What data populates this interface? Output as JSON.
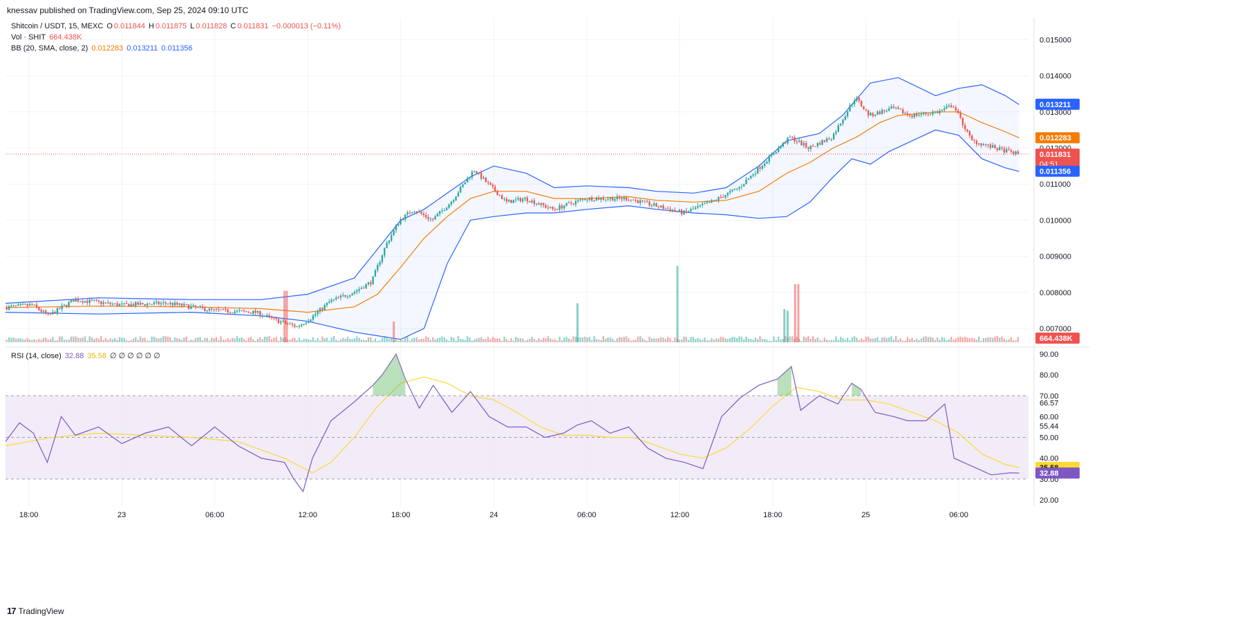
{
  "header": {
    "published": "knessav published on TradingView.com, Sep 25, 2024 09:10 UTC"
  },
  "legend": {
    "symbol": "Shitcoin / USDT, 15, MEXC",
    "o_label": "O",
    "o": "0.011844",
    "h_label": "H",
    "h": "0.011875",
    "l_label": "L",
    "l": "0.011828",
    "c_label": "C",
    "c": "0.011831",
    "change": "−0.000013 (−0.11%)",
    "vol_label": "Vol · SHIT",
    "vol_value": "664.438K",
    "bb_label": "BB (20, SMA, close, 2)",
    "bb_basis": "0.012283",
    "bb_upper": "0.013211",
    "bb_lower": "0.011356",
    "rsi_label": "RSI (14, close)",
    "rsi_value": "32.88",
    "rsi_ma": "35.58",
    "rsi_extra": "∅ ∅ ∅ ∅ ∅ ∅"
  },
  "badges": {
    "upper": "0.013211",
    "basis": "0.012283",
    "price": "0.011831",
    "countdown": "04:51",
    "lower": "0.011356",
    "volume": "664.438K",
    "rsi_ma": "35.58",
    "rsi": "32.88"
  },
  "footer": {
    "brand": "TradingView"
  },
  "colors": {
    "up": "#26a69a",
    "down": "#ef5350",
    "bb_band": "#2962ff",
    "bb_basis": "#f57c00",
    "rsi_line": "#7e57c2",
    "rsi_ma": "#fdd835",
    "rsi_bg": "#ede7f6",
    "price_line": "#ef5350"
  },
  "chart_data": [
    {
      "type": "candlestick",
      "title": "Shitcoin / USDT, 15, MEXC",
      "y_tick_labels": [
        "0.015000",
        "0.014000",
        "0.013000",
        "0.012000",
        "0.011000",
        "0.010000",
        "0.009000",
        "0.008000",
        "0.007000"
      ],
      "y_ticks": [
        0.015,
        0.014,
        0.013,
        0.012,
        0.011,
        0.01,
        0.009,
        0.008,
        0.007
      ],
      "ylim": [
        0.0066,
        0.0156
      ],
      "x_labels": [
        "18:00",
        "23",
        "06:00",
        "12:00",
        "18:00",
        "24",
        "06:00",
        "12:00",
        "18:00",
        "25",
        "06:00"
      ],
      "x_label_pos": [
        0.5,
        2.5,
        4.5,
        6.5,
        8.5,
        10.5,
        12.5,
        14.5,
        16.5,
        18.5,
        20.5
      ],
      "x_start": 0,
      "x_end": 22.0,
      "current_price": 0.011831,
      "close_path": [
        [
          0.0,
          0.00758
        ],
        [
          0.6,
          0.00765
        ],
        [
          0.95,
          0.00735
        ],
        [
          1.5,
          0.0078
        ],
        [
          2.5,
          0.00765
        ],
        [
          3.5,
          0.0077
        ],
        [
          4.5,
          0.0075
        ],
        [
          5.4,
          0.00745
        ],
        [
          5.9,
          0.0072
        ],
        [
          6.3,
          0.00705
        ],
        [
          6.6,
          0.0073
        ],
        [
          7.0,
          0.00775
        ],
        [
          7.5,
          0.008
        ],
        [
          7.9,
          0.0083
        ],
        [
          8.2,
          0.0093
        ],
        [
          8.5,
          0.01
        ],
        [
          8.8,
          0.0103
        ],
        [
          9.2,
          0.01
        ],
        [
          9.6,
          0.0105
        ],
        [
          10.1,
          0.0114
        ],
        [
          10.4,
          0.011
        ],
        [
          10.8,
          0.0105
        ],
        [
          11.2,
          0.0106
        ],
        [
          11.8,
          0.0103
        ],
        [
          12.5,
          0.0106
        ],
        [
          13.4,
          0.0106
        ],
        [
          14.0,
          0.0104
        ],
        [
          14.6,
          0.0102
        ],
        [
          15.2,
          0.0105
        ],
        [
          15.8,
          0.0109
        ],
        [
          16.5,
          0.0118
        ],
        [
          16.9,
          0.0123
        ],
        [
          17.3,
          0.012
        ],
        [
          17.8,
          0.0123
        ],
        [
          18.3,
          0.0134
        ],
        [
          18.6,
          0.0129
        ],
        [
          19.1,
          0.0131
        ],
        [
          19.5,
          0.0129
        ],
        [
          20.1,
          0.013
        ],
        [
          20.4,
          0.0132
        ],
        [
          20.8,
          0.0122
        ],
        [
          21.3,
          0.012
        ],
        [
          21.8,
          0.01183
        ],
        [
          22.0,
          0.01183
        ]
      ],
      "bb_upper_path": [
        [
          0.0,
          0.0077
        ],
        [
          2.0,
          0.00785
        ],
        [
          4.0,
          0.0078
        ],
        [
          5.5,
          0.0078
        ],
        [
          6.5,
          0.00795
        ],
        [
          7.5,
          0.0084
        ],
        [
          8.0,
          0.0092
        ],
        [
          8.5,
          0.01
        ],
        [
          9.0,
          0.0103
        ],
        [
          10.0,
          0.0112
        ],
        [
          10.5,
          0.0115
        ],
        [
          11.2,
          0.0113
        ],
        [
          11.8,
          0.0109
        ],
        [
          12.5,
          0.01095
        ],
        [
          13.4,
          0.0109
        ],
        [
          14.0,
          0.0108
        ],
        [
          14.8,
          0.01075
        ],
        [
          15.5,
          0.0109
        ],
        [
          16.2,
          0.0115
        ],
        [
          16.8,
          0.0122
        ],
        [
          17.5,
          0.0124
        ],
        [
          18.0,
          0.0129
        ],
        [
          18.6,
          0.0138
        ],
        [
          19.2,
          0.01395
        ],
        [
          20.0,
          0.01345
        ],
        [
          20.5,
          0.01365
        ],
        [
          21.0,
          0.01375
        ],
        [
          21.5,
          0.01345
        ],
        [
          21.8,
          0.0132
        ]
      ],
      "bb_lower_path": [
        [
          0.0,
          0.00745
        ],
        [
          2.0,
          0.0074
        ],
        [
          4.0,
          0.00745
        ],
        [
          5.5,
          0.00735
        ],
        [
          6.5,
          0.0072
        ],
        [
          7.5,
          0.0069
        ],
        [
          8.0,
          0.0068
        ],
        [
          8.5,
          0.0067
        ],
        [
          9.0,
          0.007
        ],
        [
          9.5,
          0.0088
        ],
        [
          10.0,
          0.01
        ],
        [
          10.5,
          0.0101
        ],
        [
          11.2,
          0.0102
        ],
        [
          11.8,
          0.0102
        ],
        [
          12.5,
          0.0103
        ],
        [
          13.4,
          0.0104
        ],
        [
          14.0,
          0.0103
        ],
        [
          14.8,
          0.0102
        ],
        [
          15.5,
          0.01015
        ],
        [
          16.2,
          0.01005
        ],
        [
          16.8,
          0.0101
        ],
        [
          17.3,
          0.0105
        ],
        [
          17.8,
          0.0112
        ],
        [
          18.2,
          0.0117
        ],
        [
          18.6,
          0.01155
        ],
        [
          19.0,
          0.0119
        ],
        [
          20.0,
          0.0125
        ],
        [
          20.5,
          0.01235
        ],
        [
          21.0,
          0.0117
        ],
        [
          21.5,
          0.01145
        ],
        [
          21.8,
          0.01135
        ]
      ],
      "bb_basis_path": [
        [
          0.0,
          0.00758
        ],
        [
          2.0,
          0.00762
        ],
        [
          4.0,
          0.0076
        ],
        [
          5.5,
          0.00755
        ],
        [
          6.5,
          0.00745
        ],
        [
          7.5,
          0.0076
        ],
        [
          8.0,
          0.00795
        ],
        [
          8.5,
          0.0087
        ],
        [
          9.0,
          0.0095
        ],
        [
          9.5,
          0.0101
        ],
        [
          10.0,
          0.0106
        ],
        [
          10.5,
          0.0108
        ],
        [
          11.2,
          0.0108
        ],
        [
          11.8,
          0.0106
        ],
        [
          12.5,
          0.0106
        ],
        [
          13.4,
          0.01065
        ],
        [
          14.0,
          0.01055
        ],
        [
          14.8,
          0.0105
        ],
        [
          15.5,
          0.01055
        ],
        [
          16.2,
          0.0108
        ],
        [
          16.8,
          0.0113
        ],
        [
          17.3,
          0.0116
        ],
        [
          17.8,
          0.012
        ],
        [
          18.3,
          0.0123
        ],
        [
          18.8,
          0.0127
        ],
        [
          19.2,
          0.0129
        ],
        [
          20.0,
          0.013
        ],
        [
          20.5,
          0.013
        ],
        [
          21.0,
          0.0127
        ],
        [
          21.5,
          0.01245
        ],
        [
          21.8,
          0.01228
        ]
      ],
      "volume_spikes": [
        {
          "x": 6.0,
          "v": 0.62,
          "dir": "down"
        },
        {
          "x": 6.05,
          "v": 0.62,
          "dir": "down"
        },
        {
          "x": 8.35,
          "v": 0.25,
          "dir": "down"
        },
        {
          "x": 12.3,
          "v": 0.47,
          "dir": "up"
        },
        {
          "x": 14.45,
          "v": 0.92,
          "dir": "up"
        },
        {
          "x": 16.75,
          "v": 0.4,
          "dir": "up"
        },
        {
          "x": 16.82,
          "v": 0.38,
          "dir": "up"
        },
        {
          "x": 16.98,
          "v": 0.7,
          "dir": "down"
        },
        {
          "x": 17.05,
          "v": 0.7,
          "dir": "down"
        }
      ]
    },
    {
      "type": "line",
      "title": "RSI (14, close)",
      "y_tick_labels": [
        "90.00",
        "80.00",
        "70.00",
        "66.57",
        "60.00",
        "55.44",
        "50.00",
        "40.00",
        "30.00",
        "20.00"
      ],
      "y_ticks": [
        90,
        80,
        70,
        66.57,
        60,
        55.44,
        50,
        40,
        30,
        20
      ],
      "ylim": [
        17,
        92
      ],
      "bands": {
        "upper": 70,
        "middle": 50,
        "lower": 30
      },
      "series": [
        {
          "name": "RSI",
          "values_path": [
            [
              0.0,
              48
            ],
            [
              0.3,
              57
            ],
            [
              0.6,
              52
            ],
            [
              0.9,
              38
            ],
            [
              1.2,
              60
            ],
            [
              1.5,
              51
            ],
            [
              2.0,
              55
            ],
            [
              2.5,
              47
            ],
            [
              3.0,
              52
            ],
            [
              3.5,
              55
            ],
            [
              4.0,
              46
            ],
            [
              4.5,
              55
            ],
            [
              5.0,
              46
            ],
            [
              5.5,
              40
            ],
            [
              6.0,
              38
            ],
            [
              6.2,
              30
            ],
            [
              6.4,
              24
            ],
            [
              6.6,
              40
            ],
            [
              7.0,
              58
            ],
            [
              7.5,
              67
            ],
            [
              7.9,
              75
            ],
            [
              8.1,
              80
            ],
            [
              8.4,
              90
            ],
            [
              8.6,
              78
            ],
            [
              8.9,
              64
            ],
            [
              9.2,
              75
            ],
            [
              9.6,
              62
            ],
            [
              10.0,
              72
            ],
            [
              10.4,
              60
            ],
            [
              10.8,
              55
            ],
            [
              11.2,
              55
            ],
            [
              11.6,
              50
            ],
            [
              12.0,
              52
            ],
            [
              12.3,
              56
            ],
            [
              12.6,
              58
            ],
            [
              13.0,
              52
            ],
            [
              13.4,
              55
            ],
            [
              13.8,
              45
            ],
            [
              14.2,
              40
            ],
            [
              14.6,
              38
            ],
            [
              15.0,
              35
            ],
            [
              15.4,
              60
            ],
            [
              15.8,
              69
            ],
            [
              16.2,
              75
            ],
            [
              16.6,
              78
            ],
            [
              16.9,
              84
            ],
            [
              17.1,
              63
            ],
            [
              17.5,
              70
            ],
            [
              17.9,
              66
            ],
            [
              18.2,
              76
            ],
            [
              18.4,
              73
            ],
            [
              18.7,
              62
            ],
            [
              19.1,
              60
            ],
            [
              19.4,
              58
            ],
            [
              19.8,
              58
            ],
            [
              20.2,
              66
            ],
            [
              20.4,
              40
            ],
            [
              20.8,
              36
            ],
            [
              21.2,
              32
            ],
            [
              21.6,
              33
            ],
            [
              21.8,
              32.88
            ]
          ]
        },
        {
          "name": "RSI-based MA",
          "values_path": [
            [
              0.0,
              46
            ],
            [
              1.0,
              50
            ],
            [
              2.0,
              52
            ],
            [
              3.0,
              51
            ],
            [
              4.0,
              50
            ],
            [
              5.0,
              48
            ],
            [
              6.0,
              40
            ],
            [
              6.6,
              33
            ],
            [
              7.0,
              38
            ],
            [
              7.5,
              50
            ],
            [
              8.0,
              65
            ],
            [
              8.5,
              76
            ],
            [
              9.0,
              79
            ],
            [
              9.5,
              76
            ],
            [
              10.0,
              70
            ],
            [
              10.5,
              68
            ],
            [
              11.0,
              62
            ],
            [
              11.5,
              55
            ],
            [
              12.0,
              51
            ],
            [
              12.5,
              51
            ],
            [
              13.0,
              50
            ],
            [
              13.5,
              50
            ],
            [
              14.0,
              46
            ],
            [
              14.5,
              42
            ],
            [
              15.0,
              40
            ],
            [
              15.5,
              45
            ],
            [
              16.0,
              54
            ],
            [
              16.5,
              65
            ],
            [
              17.0,
              74
            ],
            [
              17.5,
              72
            ],
            [
              18.0,
              68
            ],
            [
              18.5,
              68
            ],
            [
              19.0,
              66
            ],
            [
              19.5,
              62
            ],
            [
              20.0,
              58
            ],
            [
              20.5,
              52
            ],
            [
              21.0,
              42
            ],
            [
              21.5,
              37
            ],
            [
              21.8,
              35.58
            ]
          ]
        }
      ]
    }
  ]
}
